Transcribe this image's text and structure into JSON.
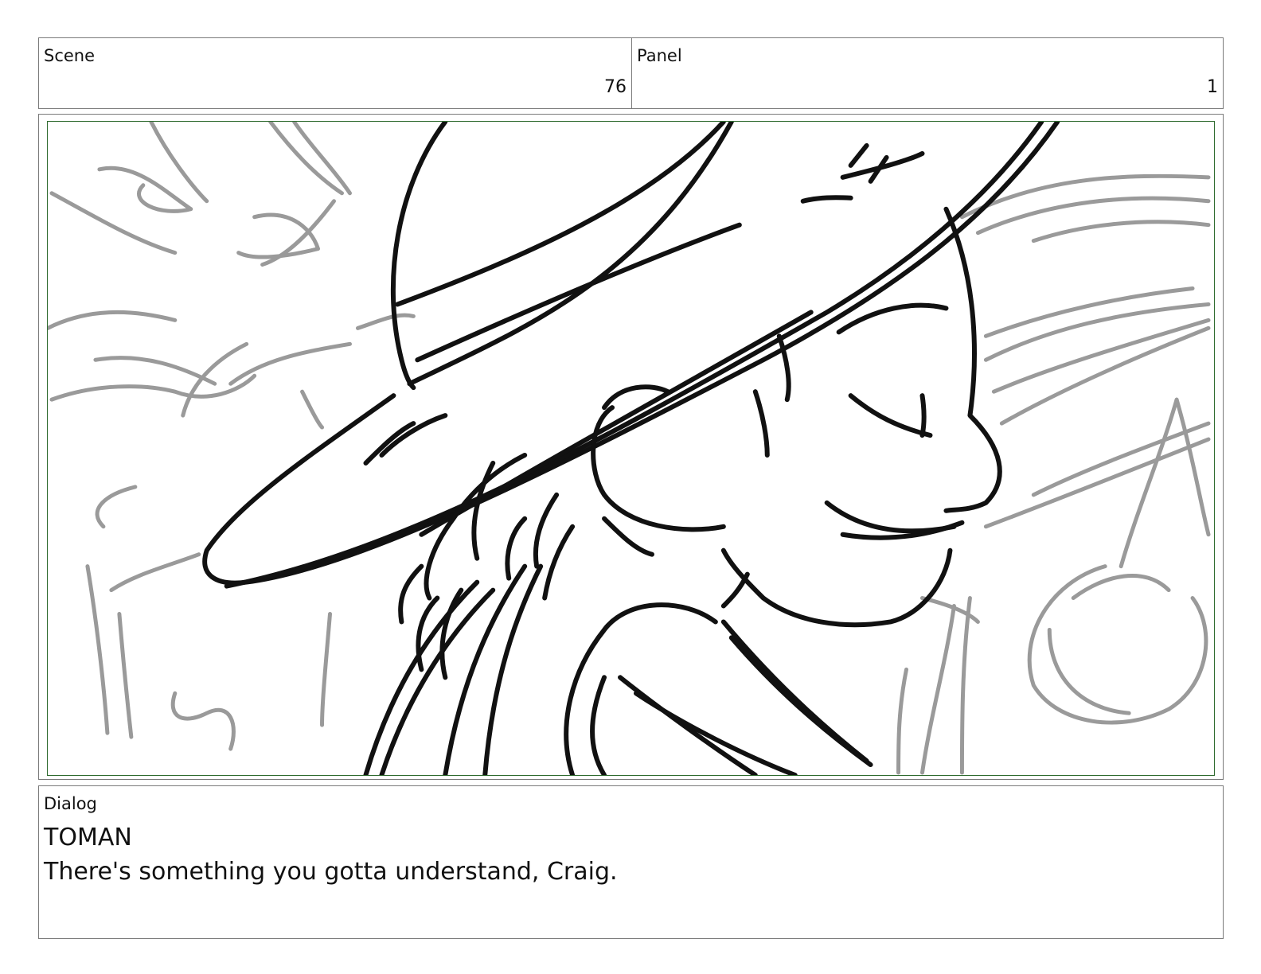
{
  "header": {
    "scene_label": "Scene",
    "scene_value": "76",
    "panel_label": "Panel",
    "panel_value": "1"
  },
  "dialog": {
    "label": "Dialog",
    "character": "TOMAN",
    "line": "There's something you gotta understand, Craig."
  },
  "colors": {
    "frame_border": "#2f6b2f",
    "ink": "#111111",
    "sketch": "#9a9a9a"
  }
}
